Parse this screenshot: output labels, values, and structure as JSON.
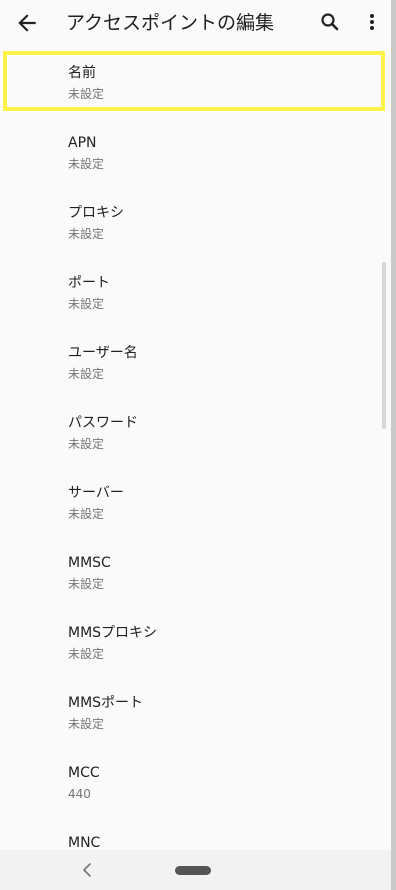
{
  "app_bar": {
    "title": "アクセスポイントの編集",
    "back_icon": "arrow-back-icon",
    "search_icon": "search-icon",
    "more_icon": "more-vert-icon"
  },
  "items": [
    {
      "title": "名前",
      "value": "未設定"
    },
    {
      "title": "APN",
      "value": "未設定"
    },
    {
      "title": "プロキシ",
      "value": "未設定"
    },
    {
      "title": "ポート",
      "value": "未設定"
    },
    {
      "title": "ユーザー名",
      "value": "未設定"
    },
    {
      "title": "パスワード",
      "value": "未設定"
    },
    {
      "title": "サーバー",
      "value": "未設定"
    },
    {
      "title": "MMSC",
      "value": "未設定"
    },
    {
      "title": "MMSプロキシ",
      "value": "未設定"
    },
    {
      "title": "MMSポート",
      "value": "未設定"
    },
    {
      "title": "MCC",
      "value": "440"
    },
    {
      "title": "MNC",
      "value": ""
    }
  ],
  "highlight_color": "#fff34a",
  "nav_bar": {
    "back_icon": "nav-back-icon",
    "home_icon": "nav-home-pill-icon"
  }
}
